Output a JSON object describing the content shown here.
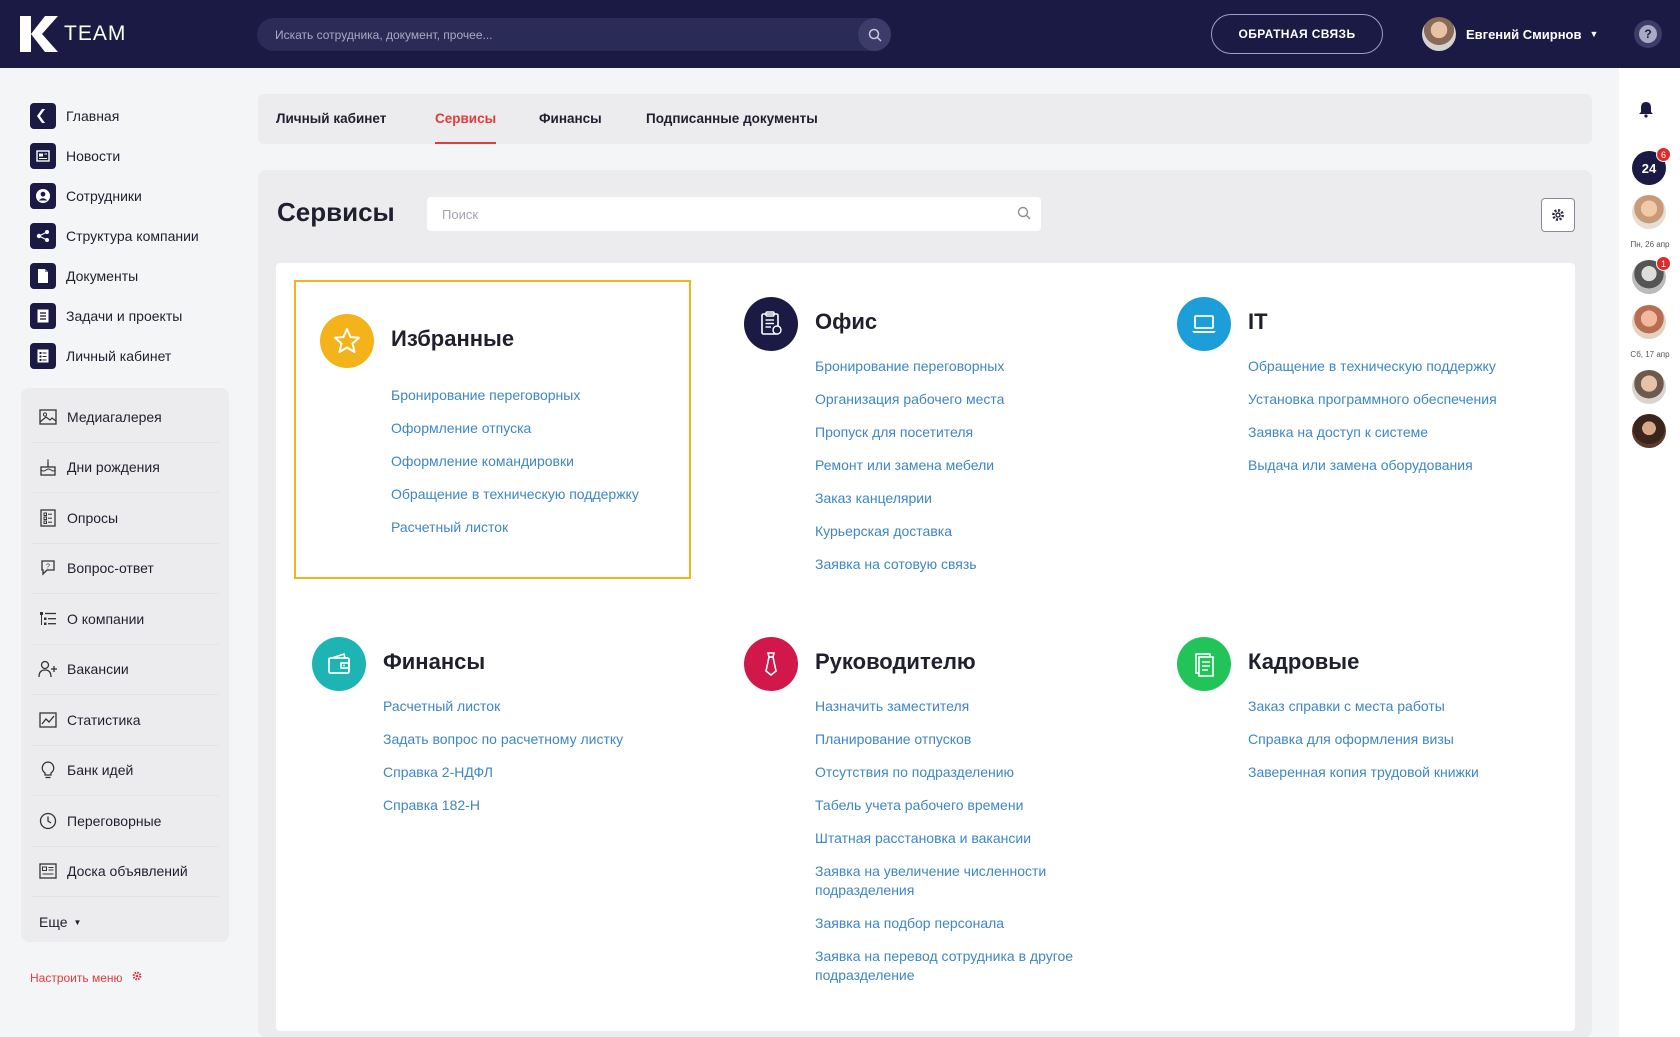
{
  "brand": {
    "logo_text": "TEAM"
  },
  "header": {
    "search_placeholder": "Искать сотрудника, документ, прочее...",
    "feedback_label": "ОБРАТНАЯ СВЯЗЬ",
    "user_name": "Евгений Смирнов"
  },
  "sidebar": {
    "main": [
      {
        "label": "Главная",
        "icon": "home-icon"
      },
      {
        "label": "Новости",
        "icon": "news-icon"
      },
      {
        "label": "Сотрудники",
        "icon": "employees-icon"
      },
      {
        "label": "Структура компании",
        "icon": "structure-icon"
      },
      {
        "label": "Документы",
        "icon": "document-icon"
      },
      {
        "label": "Задачи и проекты",
        "icon": "tasks-icon"
      },
      {
        "label": "Личный кабинет",
        "icon": "cabinet-icon"
      }
    ],
    "extra": [
      {
        "label": "Медиагалерея",
        "icon": "gallery-icon"
      },
      {
        "label": "Дни рождения",
        "icon": "cake-icon"
      },
      {
        "label": "Опросы",
        "icon": "poll-icon"
      },
      {
        "label": "Вопрос-ответ",
        "icon": "faq-icon"
      },
      {
        "label": "О компании",
        "icon": "about-icon"
      },
      {
        "label": "Вакансии",
        "icon": "vacancy-icon"
      },
      {
        "label": "Статистика",
        "icon": "stats-icon"
      },
      {
        "label": "Банк идей",
        "icon": "idea-icon"
      },
      {
        "label": "Переговорные",
        "icon": "clock-icon"
      },
      {
        "label": "Доска объявлений",
        "icon": "board-icon"
      }
    ],
    "more_label": "Еще",
    "setup_label": "Настроить меню"
  },
  "tabs": [
    {
      "label": "Личный кабинет",
      "active": false
    },
    {
      "label": "Сервисы",
      "active": true
    },
    {
      "label": "Финансы",
      "active": false
    },
    {
      "label": "Подписанные документы",
      "active": false
    }
  ],
  "services": {
    "title": "Сервисы",
    "search_placeholder": "Поиск",
    "categories": [
      {
        "id": "favorites",
        "title": "Избранные",
        "color": "#f4b31b",
        "icon": "star-icon",
        "links": [
          "Бронирование переговорных",
          "Оформление отпуска",
          "Оформление командировки",
          "Обращение в техническую поддержку",
          "Расчетный листок"
        ]
      },
      {
        "id": "office",
        "title": "Офис",
        "color": "#1a1a44",
        "icon": "office-icon",
        "links": [
          "Бронирование переговорных",
          "Организация рабочего места",
          "Пропуск для посетителя",
          "Ремонт или замена мебели",
          "Заказ канцелярии",
          "Курьерская доставка",
          "Заявка на сотовую связь"
        ]
      },
      {
        "id": "it",
        "title": "IT",
        "color": "#1e9ed8",
        "icon": "laptop-icon",
        "links": [
          "Обращение в техническую поддержку",
          "Установка программного обеспечения",
          "Заявка на доступ к системе",
          "Выдача или замена оборудования"
        ]
      },
      {
        "id": "finance",
        "title": "Финансы",
        "color": "#1fb4b4",
        "icon": "wallet-icon",
        "links": [
          "Расчетный листок",
          "Задать вопрос по расчетному листку",
          "Справка 2-НДФЛ",
          "Справка 182-Н"
        ]
      },
      {
        "id": "manager",
        "title": "Руководителю",
        "color": "#d2184b",
        "icon": "tie-icon",
        "links": [
          "Назначить заместителя",
          "Планирование отпусков",
          "Отсутствия по подразделению",
          "Табель учета рабочего времени",
          "Штатная расстановка и вакансии",
          "Заявка на увеличение численности подразделения",
          "Заявка на подбор персонала",
          "Заявка на перевод сотрудника в другое подразделение"
        ]
      },
      {
        "id": "hr",
        "title": "Кадровые",
        "color": "#22c45a",
        "icon": "hr-doc-icon",
        "links": [
          "Заказ справки с места работы",
          "Справка для оформления визы",
          "Заверенная копия трудовой книжки"
        ]
      }
    ]
  },
  "rail": {
    "badge_24": "24",
    "badge_24_count": "6",
    "avatar_badge_count": "1",
    "date1": "Пн, 26 апр",
    "date2": "Сб, 17 апр"
  },
  "colors": {
    "accent": "#e03b3b",
    "navy": "#1a1a44",
    "link": "#3e86c6",
    "fav_border": "#f4b31b"
  }
}
